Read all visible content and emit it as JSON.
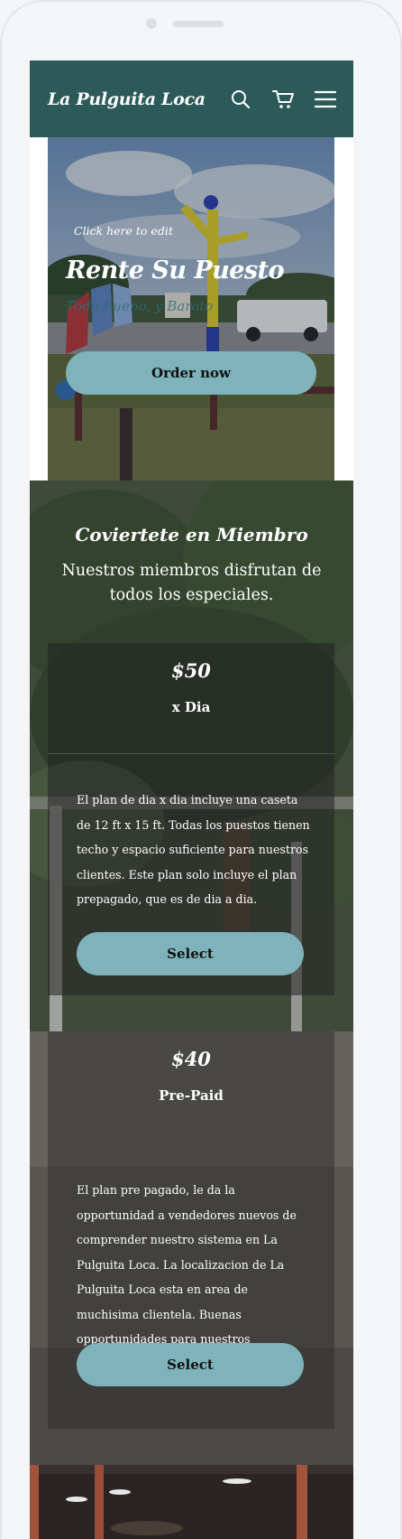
{
  "header": {
    "brand": "La Pulguita Loca",
    "icons": [
      "search-icon",
      "cart-icon",
      "menu-icon"
    ]
  },
  "hero": {
    "edit_hint": "Click here to edit",
    "title": "Rente Su Puesto",
    "subtitle": "Todo Bueno, y Barato",
    "cta_label": "Order now"
  },
  "members": {
    "title": "Coviertete en Miembro",
    "subtitle": "Nuestros miembros disfrutan de todos los especiales.",
    "plans": [
      {
        "price": "$50",
        "name": "x Dia",
        "description": "El plan de dia x dia incluye una caseta de 12 ft x 15 ft. Todas los puestos tienen techo y espacio suficiente para nuestros clientes. Este plan solo incluye el plan prepagado, que es de dia a dia.",
        "button": "Select"
      },
      {
        "price": "$40",
        "name": "Pre-Paid",
        "description": "El plan pre pagado, le da la opportunidad a vendedores nuevos de comprender nuestro sistema en La Pulguita Loca. La localizacion de La Pulguita Loca esta en area de muchisima clientela. Buenas opportunidades para nuestros vendedores.",
        "button": "Select"
      }
    ]
  },
  "colors": {
    "header_bg": "#2b5a58",
    "button_bg": "#7eb3bb",
    "frame_bg": "#f4f5f7"
  }
}
